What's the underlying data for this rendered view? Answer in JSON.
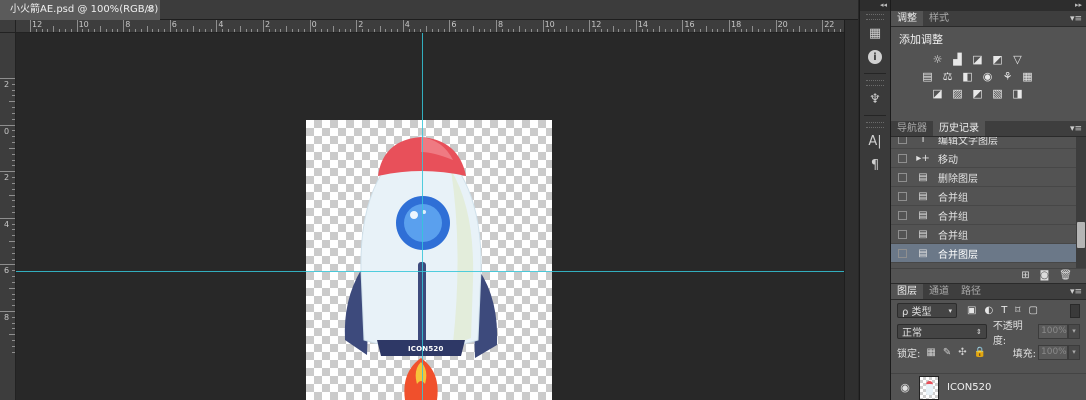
{
  "document": {
    "tab_title": "小火箭AE.psd @ 100%(RGB/8)",
    "close_glyph": "×"
  },
  "rulers": {
    "horizontal_labels": [
      "12",
      "10",
      "8",
      "6",
      "4",
      "2",
      "0",
      "2",
      "4",
      "6",
      "8",
      "10",
      "12",
      "14",
      "16",
      "18",
      "20",
      "22"
    ],
    "vertical_labels": [
      "2",
      "0",
      "2",
      "4",
      "6",
      "8"
    ]
  },
  "canvas": {
    "rocket_text": "ICON520",
    "guide_color": "#34c6d8",
    "body_color": "#e8f2f8",
    "nose_color": "#e8505a",
    "window_color": "#2f6fd6",
    "fin_color": "#3d4a7c",
    "flame_color": "#f0502c"
  },
  "toolstrip": {
    "icons": [
      "history-panel-icon",
      "info-icon",
      "brush-presets-icon",
      "character-icon",
      "paragraph-icon"
    ]
  },
  "adjustments": {
    "tabs": [
      "调整",
      "样式"
    ],
    "title": "添加调整"
  },
  "history": {
    "tabs": [
      "导航器",
      "历史记录"
    ],
    "items": [
      {
        "label": "编辑文字图层",
        "icon": "T"
      },
      {
        "label": "移动",
        "icon": "▸+"
      },
      {
        "label": "删除图层",
        "icon": "▤"
      },
      {
        "label": "合并组",
        "icon": "▤"
      },
      {
        "label": "合并组",
        "icon": "▤"
      },
      {
        "label": "合并组",
        "icon": "▤"
      },
      {
        "label": "合并图层",
        "icon": "▤"
      }
    ],
    "footer_icons": [
      "⊞",
      "◙",
      "🗑"
    ]
  },
  "layers": {
    "tabs": [
      "图层",
      "通道",
      "路径"
    ],
    "filter_type": "ρ 类型",
    "blend_mode": "正常",
    "opacity_label": "不透明度:",
    "opacity_value": "100%",
    "lock_label": "锁定:",
    "fill_label": "填充:",
    "fill_value": "100%",
    "layer_name": "ICON520"
  }
}
